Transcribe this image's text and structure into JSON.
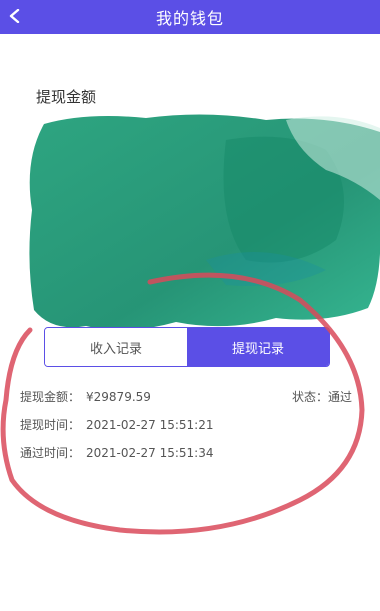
{
  "header": {
    "title": "我的钱包",
    "back_icon": "back-arrow-icon"
  },
  "wallet": {
    "amount_label": "提现金额"
  },
  "tabs": [
    {
      "label": "收入记录",
      "active": false
    },
    {
      "label": "提现记录",
      "active": true
    }
  ],
  "record": {
    "amount_label": "提现金额：",
    "amount_value": "¥29879.59",
    "status_label": "状态：",
    "status_value": "通过",
    "withdraw_time_label": "提现时间：",
    "withdraw_time_value": "2021-02-27 15:51:21",
    "approve_time_label": "通过时间：",
    "approve_time_value": "2021-02-27 15:51:34"
  },
  "colors": {
    "accent": "#5b4fe6",
    "blot": "#1f9a78",
    "scribble": "#d94a5a"
  }
}
